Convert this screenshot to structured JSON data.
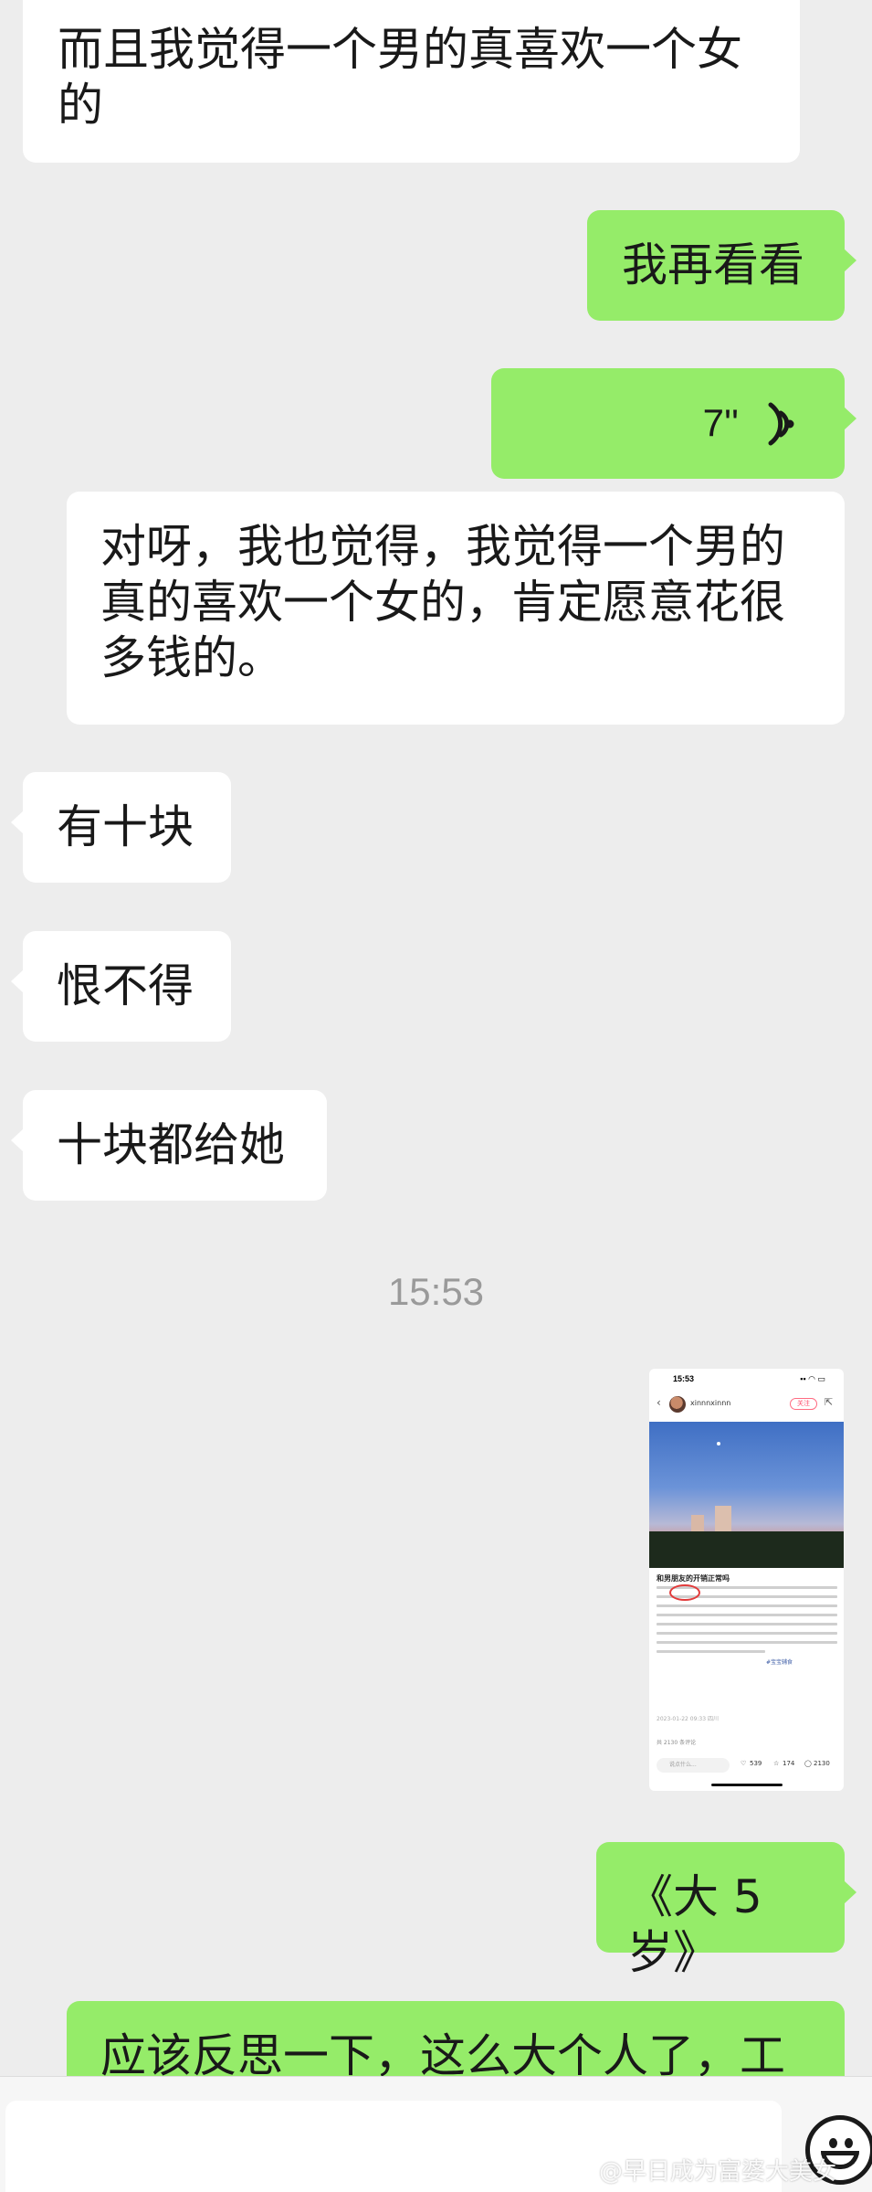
{
  "messages": [
    {
      "side": "left",
      "text_lines": [
        "而且我觉得一个男的真喜欢一个女",
        "的"
      ]
    },
    {
      "side": "right",
      "text": "我再看看"
    },
    {
      "side": "right",
      "type": "voice",
      "duration": "7''"
    },
    {
      "side": "left",
      "text_lines": [
        "对呀，我也觉得，我觉得一个男的",
        "真的喜欢一个女的，肯定愿意花很",
        "多钱的。"
      ]
    },
    {
      "side": "left",
      "text": "有十块"
    },
    {
      "side": "left",
      "text": "恨不得"
    },
    {
      "side": "left",
      "text": "十块都给她"
    },
    {
      "side": "right",
      "text": "《大 5 岁》"
    },
    {
      "side": "right",
      "text": "应该反思一下，这么大个人了，工"
    }
  ],
  "timestamp": "15:53",
  "image_message": {
    "status_time": "15:53",
    "username": "xinnnxinnn",
    "follow_label": "关注",
    "post_title": "和男朋友的开销正常吗",
    "hashtag": "#宝宝辅食",
    "date": "2023-01-22 09:33 四川",
    "comment_count": "共 2130 条评论",
    "comment_placeholder": "说点什么...",
    "likes": "539",
    "stars": "174",
    "comments": "2130"
  },
  "watermark": "@早日成为富婆大美女",
  "colors": {
    "background": "#ededed",
    "left_bubble": "#ffffff",
    "right_bubble": "#95ec69",
    "timestamp": "#9a9a9a"
  },
  "icons": [
    "voice-wave-icon",
    "emoji-icon",
    "back-arrow-icon",
    "share-icon",
    "heart-icon",
    "star-icon",
    "comment-icon"
  ]
}
